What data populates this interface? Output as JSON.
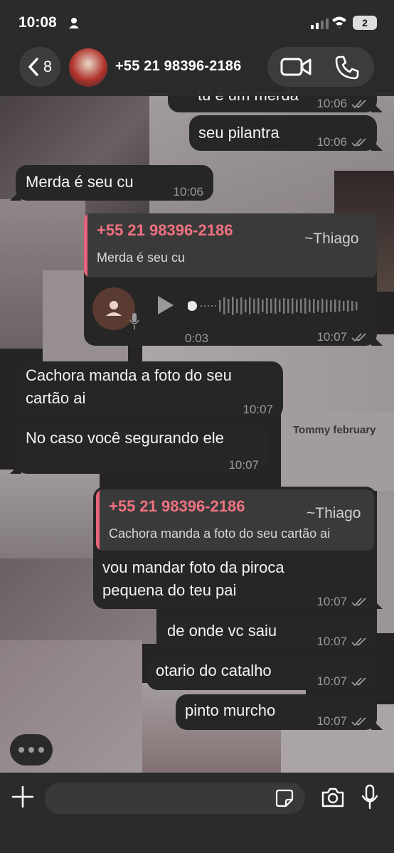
{
  "status_bar": {
    "time": "10:08",
    "battery": "2"
  },
  "header": {
    "back_count": "8",
    "contact_name": "+55 21 98396-2186"
  },
  "wallpaper": {
    "poster_text": "Tommy february"
  },
  "messages": [
    {
      "side": "out",
      "text": "tu é um merda",
      "time": "10:06",
      "read": true
    },
    {
      "side": "out",
      "text": "seu pilantra",
      "time": "10:06",
      "read": true
    },
    {
      "side": "in",
      "text": "Merda é seu cu",
      "time": "10:06"
    },
    {
      "side": "out",
      "type": "voice",
      "quote": {
        "author": "+55 21 98396-2186",
        "alias": "~Thiago",
        "text": "Merda é seu cu"
      },
      "duration": "0:03",
      "time": "10:07",
      "read": true
    },
    {
      "side": "in",
      "text_lines": [
        "Cachora manda a foto do seu",
        "cartão ai"
      ],
      "time": "10:07"
    },
    {
      "side": "in",
      "text": "No caso você segurando ele",
      "time": "10:07"
    },
    {
      "side": "out",
      "quote": {
        "author": "+55 21 98396-2186",
        "alias": "~Thiago",
        "text": "Cachora manda a foto do seu cartão ai"
      },
      "text_lines": [
        "vou mandar foto da piroca",
        "pequena do teu pai"
      ],
      "time": "10:07",
      "read": true
    },
    {
      "side": "out",
      "text": "de onde vc saiu",
      "time": "10:07",
      "read": true
    },
    {
      "side": "out",
      "text": "otario do catalho",
      "time": "10:07",
      "read": true
    },
    {
      "side": "out",
      "text": "pinto murcho",
      "time": "10:07",
      "read": true
    }
  ],
  "colors": {
    "bubble": "#262626",
    "quote_author": "#f0727f",
    "quote_bar": "#e8637d",
    "meta": "#9b9b9b"
  },
  "icons": [
    "person-icon",
    "signal-icon",
    "wifi-icon",
    "battery-icon",
    "chevron-left-icon",
    "video-icon",
    "phone-icon",
    "play-icon",
    "mic-icon",
    "plus-icon",
    "sticker-icon",
    "camera-icon",
    "read-ticks-icon",
    "typing-indicator-icon"
  ]
}
